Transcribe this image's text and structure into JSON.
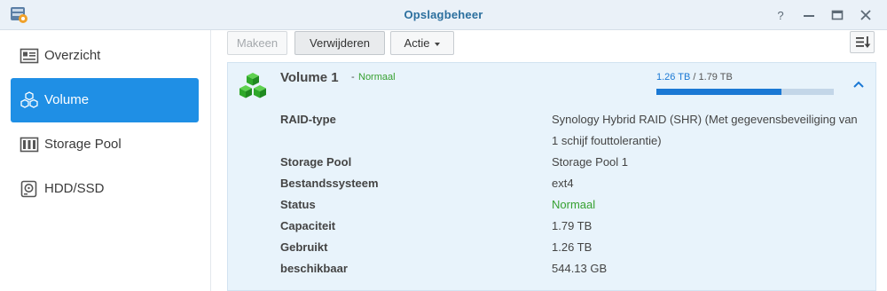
{
  "window": {
    "title": "Opslagbeheer",
    "buttons": [
      "help-icon",
      "minimize-icon",
      "maximize-icon",
      "close-icon"
    ]
  },
  "sidebar": {
    "items": [
      {
        "label": "Overzicht",
        "icon": "overview-icon",
        "active": false
      },
      {
        "label": "Volume",
        "icon": "volume-cubes-icon",
        "active": true
      },
      {
        "label": "Storage Pool",
        "icon": "storage-pool-icon",
        "active": false
      },
      {
        "label": "HDD/SSD",
        "icon": "hdd-icon",
        "active": false
      }
    ]
  },
  "toolbar": {
    "create_label": "Makeen",
    "delete_label": "Verwijderen",
    "action_label": "Actie"
  },
  "volume": {
    "name": "Volume 1",
    "separator": "-",
    "status": "Normaal",
    "used": "1.26 TB",
    "slash": "/",
    "total": "1.79 TB",
    "usage_fraction": 0.7039,
    "details": [
      {
        "label": "RAID-type",
        "value": "Synology Hybrid RAID (SHR) (Met gegevensbeveiliging van 1 schijf fouttolerantie)"
      },
      {
        "label": "Storage Pool",
        "value": "Storage Pool 1"
      },
      {
        "label": "Bestandssysteem",
        "value": "ext4"
      },
      {
        "label": "Status",
        "value": "Normaal"
      },
      {
        "label": "Capaciteit",
        "value": "1.79 TB"
      },
      {
        "label": "Gebruikt",
        "value": "1.26 TB"
      },
      {
        "label": "beschikbaar",
        "value": "544.13 GB"
      }
    ]
  },
  "colors": {
    "accent": "#1f8fe5",
    "status_ok": "#37a131",
    "panel_bg": "#e8f3fb",
    "bar_fill": "#1a78d4",
    "bar_track": "#c3d6e8"
  }
}
